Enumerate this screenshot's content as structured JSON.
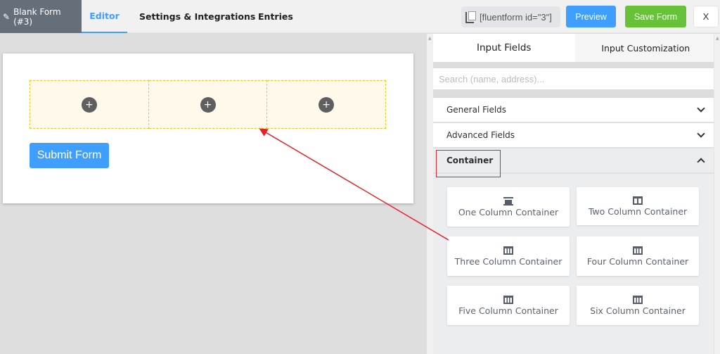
{
  "header": {
    "form_title": "Blank Form (#3)",
    "tabs": [
      {
        "label": "Editor",
        "active": true
      },
      {
        "label": "Settings & Integrations",
        "active": false
      },
      {
        "label": "Entries",
        "active": false
      }
    ],
    "shortcode": "[fluentform id=\"3\"]",
    "preview_label": "Preview",
    "save_label": "Save Form",
    "close_label": "X"
  },
  "editor": {
    "columns": [
      {
        "add_label": "+"
      },
      {
        "add_label": "+"
      },
      {
        "add_label": "+"
      }
    ],
    "submit_label": "Submit Form"
  },
  "panel": {
    "tabs": [
      {
        "label": "Input Fields",
        "active": true
      },
      {
        "label": "Input Customization",
        "active": false
      }
    ],
    "search_placeholder": "Search (name, address)...",
    "search_value": "",
    "sections": [
      {
        "label": "General Fields",
        "expanded": false
      },
      {
        "label": "Advanced Fields",
        "expanded": false
      },
      {
        "label": "Container",
        "expanded": true
      }
    ],
    "containers": [
      {
        "label": "One Column Container",
        "icon": "one-column-icon"
      },
      {
        "label": "Two Column Container",
        "icon": "two-column-icon"
      },
      {
        "label": "Three Column Container",
        "icon": "three-column-icon"
      },
      {
        "label": "Four Column Container",
        "icon": "four-column-icon"
      },
      {
        "label": "Five Column Container",
        "icon": "five-column-icon"
      },
      {
        "label": "Six Column Container",
        "icon": "six-column-icon"
      }
    ]
  },
  "colors": {
    "primary": "#409eff",
    "success": "#67c23a",
    "title_bg": "#646f79",
    "dashed_border": "#f5c02a",
    "annotation": "#e8202a"
  }
}
